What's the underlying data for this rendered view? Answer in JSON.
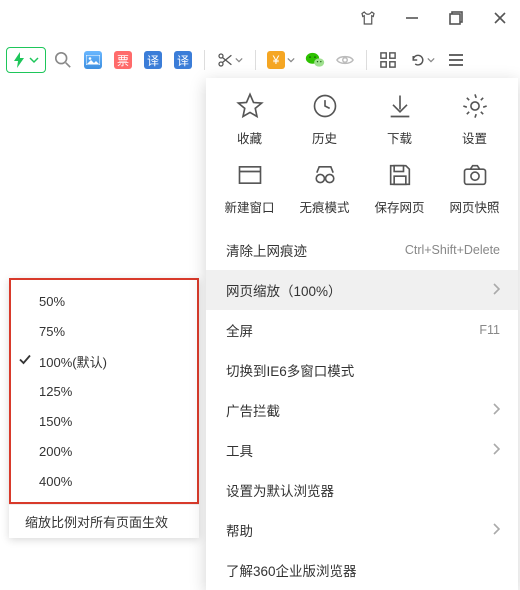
{
  "window_controls": {
    "shirt_icon": "shirt-icon",
    "minimize": "minimize",
    "maximize": "maximize",
    "close": "close"
  },
  "toolbar": {
    "picture": "图",
    "ticket": "票",
    "translate1": "译",
    "translate2": "译",
    "yuan": "¥"
  },
  "main_menu": {
    "grid": [
      {
        "label": "收藏",
        "name": "favorites"
      },
      {
        "label": "历史",
        "name": "history"
      },
      {
        "label": "下载",
        "name": "downloads"
      },
      {
        "label": "设置",
        "name": "settings"
      },
      {
        "label": "新建窗口",
        "name": "new-window"
      },
      {
        "label": "无痕模式",
        "name": "incognito"
      },
      {
        "label": "保存网页",
        "name": "save-page"
      },
      {
        "label": "网页快照",
        "name": "page-snapshot"
      }
    ],
    "list": [
      {
        "label": "清除上网痕迹",
        "hint": "Ctrl+Shift+Delete",
        "arrow": false,
        "name": "clear-browsing-data"
      },
      {
        "label": "网页缩放（100%）",
        "hint": "",
        "arrow": true,
        "highlight": true,
        "name": "page-zoom"
      },
      {
        "label": "全屏",
        "hint": "F11",
        "arrow": false,
        "name": "fullscreen"
      },
      {
        "label": "切换到IE6多窗口模式",
        "hint": "",
        "arrow": false,
        "name": "switch-ie6-mode"
      },
      {
        "label": "广告拦截",
        "hint": "",
        "arrow": true,
        "name": "ad-block"
      },
      {
        "label": "工具",
        "hint": "",
        "arrow": true,
        "name": "tools"
      },
      {
        "label": "设置为默认浏览器",
        "hint": "",
        "arrow": false,
        "name": "set-default-browser"
      },
      {
        "label": "帮助",
        "hint": "",
        "arrow": true,
        "name": "help"
      },
      {
        "label": "了解360企业版浏览器",
        "hint": "",
        "arrow": false,
        "name": "about-enterprise"
      }
    ]
  },
  "zoom_popup": {
    "options": [
      {
        "label": "50%",
        "checked": false
      },
      {
        "label": "75%",
        "checked": false
      },
      {
        "label": "100%(默认)",
        "checked": true
      },
      {
        "label": "125%",
        "checked": false
      },
      {
        "label": "150%",
        "checked": false
      },
      {
        "label": "200%",
        "checked": false
      },
      {
        "label": "400%",
        "checked": false
      }
    ],
    "footer": "缩放比例对所有页面生效"
  }
}
